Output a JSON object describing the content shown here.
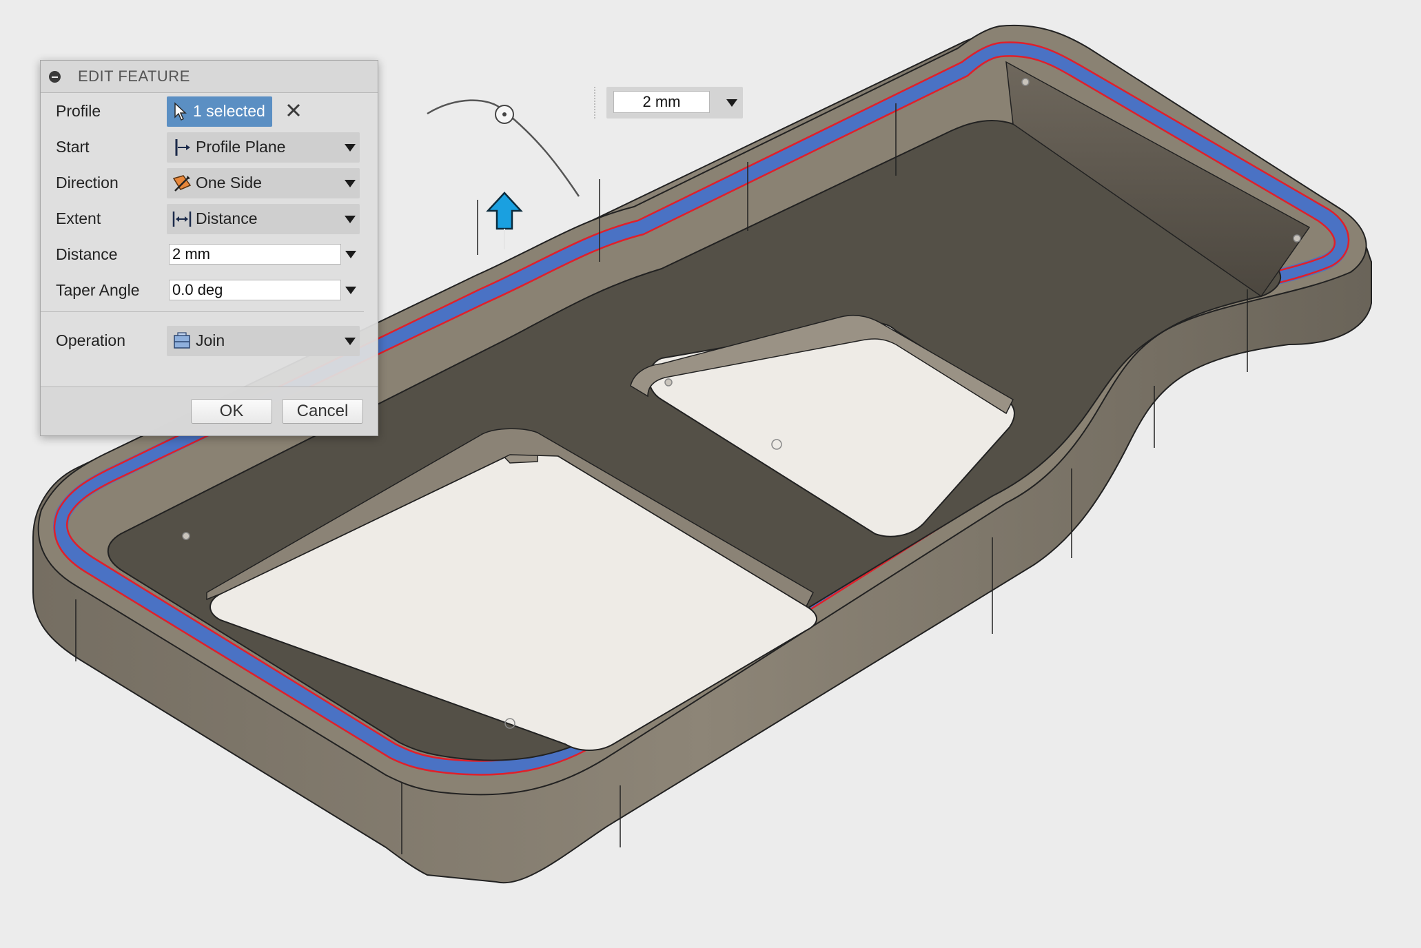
{
  "dialog": {
    "title": "EDIT FEATURE",
    "rows": {
      "profile": {
        "label": "Profile",
        "value": "1 selected"
      },
      "start": {
        "label": "Start",
        "value": "Profile Plane"
      },
      "direction": {
        "label": "Direction",
        "value": "One Side"
      },
      "extent": {
        "label": "Extent",
        "value": "Distance"
      },
      "distance": {
        "label": "Distance",
        "value": "2 mm"
      },
      "taper": {
        "label": "Taper Angle",
        "value": "0.0 deg"
      },
      "operation": {
        "label": "Operation",
        "value": "Join"
      }
    },
    "ok_label": "OK",
    "cancel_label": "Cancel"
  },
  "floating_input": {
    "value": "2 mm"
  },
  "colors": {
    "selection_blue": "#4a72c4",
    "profile_outline": "#e0202a",
    "body_top": "#8a8273",
    "accent": "#5b8fc3",
    "manipulator": "#1aa0e0"
  },
  "icons": {
    "profile": "cursor-arrow-icon",
    "start": "profile-plane-icon",
    "direction": "one-side-icon",
    "extent": "distance-icon",
    "operation": "join-icon",
    "manipulator": "drag-arrow-icon"
  }
}
